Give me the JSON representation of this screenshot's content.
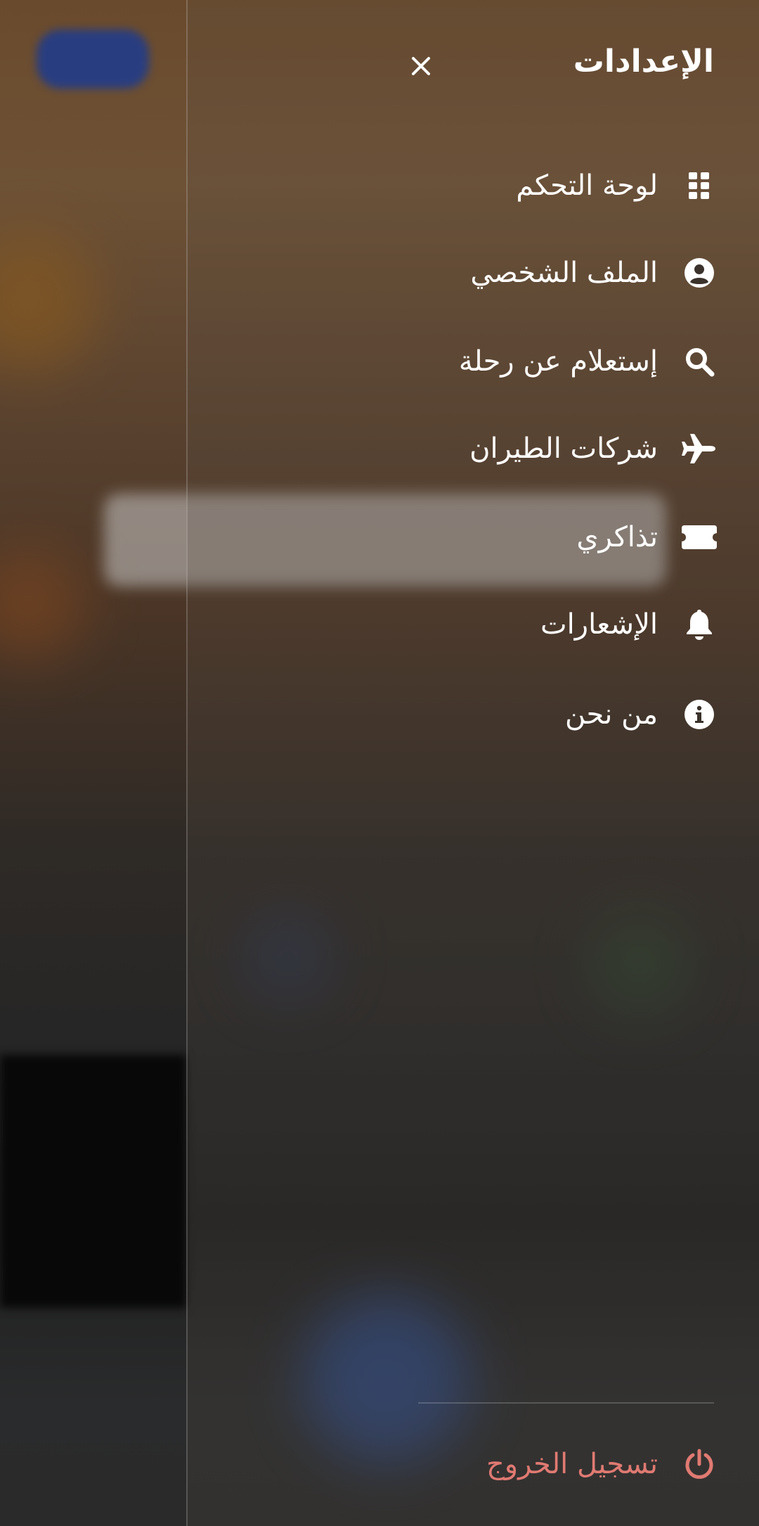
{
  "drawer": {
    "title": "الإعدادات",
    "close_icon": "close-icon",
    "items": [
      {
        "label": "لوحة التحكم",
        "icon": "dashboard-grid-icon"
      },
      {
        "label": "الملف الشخصي",
        "icon": "user-circle-icon"
      },
      {
        "label": "إستعلام عن رحلة",
        "icon": "search-icon"
      },
      {
        "label": "شركات الطيران",
        "icon": "airplane-icon"
      },
      {
        "label": "تذاكري",
        "icon": "ticket-icon"
      },
      {
        "label": "الإشعارات",
        "icon": "bell-icon"
      },
      {
        "label": "من نحن",
        "icon": "info-icon"
      }
    ],
    "logout": {
      "label": "تسجيل الخروج",
      "icon": "power-icon"
    }
  },
  "colors": {
    "text": "#ffffff",
    "logout": "#e07a72"
  }
}
